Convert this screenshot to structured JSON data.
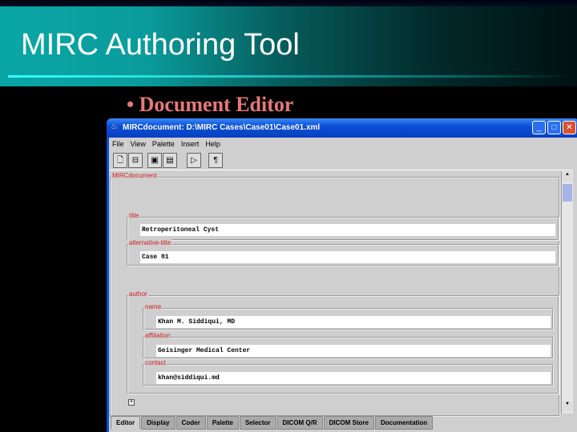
{
  "slide": {
    "title": "MIRC Authoring Tool",
    "bullet": "Document Editor"
  },
  "window": {
    "title": "MIRCdocument: D:\\MIRC Cases\\Case01\\Case01.xml"
  },
  "menu": [
    "File",
    "View",
    "Palette",
    "Insert",
    "Help"
  ],
  "toolbar": {
    "pilcrow": "¶"
  },
  "document": {
    "root_label": "MIRCdocument",
    "title": {
      "label": "title",
      "value": "Retroperitoneal Cyst"
    },
    "alt_title": {
      "label": "alternative-title",
      "value": "Case 01"
    },
    "author": {
      "label": "author",
      "name": {
        "label": "name",
        "value": "Khan M. Siddiqui, MD"
      },
      "affiliation": {
        "label": "affiliation",
        "value": "Geisinger Medical Center"
      },
      "contact": {
        "label": "contact",
        "value": "khan@siddiqui.md"
      }
    },
    "add": "+"
  },
  "tabs": [
    "Editor",
    "Display",
    "Coder",
    "Palette",
    "Selector",
    "DICOM Q/R",
    "DICOM Store",
    "Documentation"
  ]
}
